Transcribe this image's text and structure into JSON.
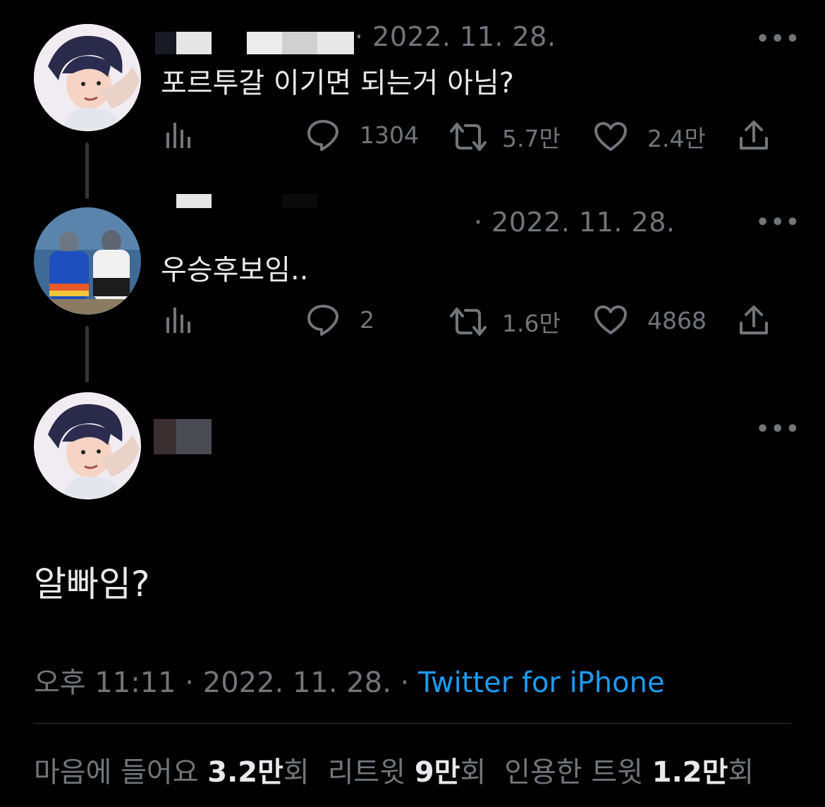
{
  "colors": {
    "background": "#000000",
    "text": "#e7e9ea",
    "muted": "#71767b",
    "link": "#1d9bf0"
  },
  "tweets": [
    {
      "date": "· 2022. 11. 28.",
      "text": "포르투갈 이기면 되는거 아님?",
      "views_icon": "analytics-icon",
      "replies": "1304",
      "retweets": "5.7만",
      "likes": "2.4만",
      "more": "•••"
    },
    {
      "date": "· 2022. 11. 28.",
      "text": "우승후보임..",
      "views_icon": "analytics-icon",
      "replies": "2",
      "retweets": "1.6만",
      "likes": "4868",
      "more": "•••"
    }
  ],
  "main_tweet": {
    "more": "•••",
    "text": "알빠임?",
    "time": "오후 11:11",
    "date": "2022. 11. 28.",
    "separator": " · ",
    "source": "Twitter for iPhone",
    "stats": {
      "likes_label": "마음에 들어요",
      "likes_value": "3.2만",
      "retweets_label": "리트윗",
      "retweets_value": "9만",
      "quotes_label": "인용한 트윗",
      "quotes_value": "1.2만",
      "unit": "회"
    }
  }
}
